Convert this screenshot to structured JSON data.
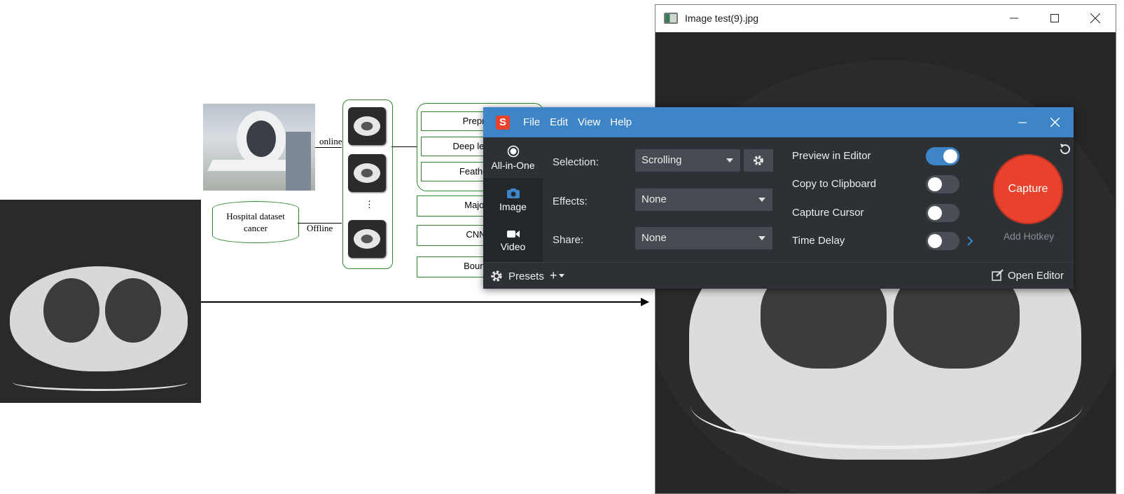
{
  "diagram": {
    "online_label": "online",
    "offline_label": "Offline",
    "dataset_label": "Hospital dataset cancer",
    "ellipsis": "⋮",
    "steps": [
      "Preproce",
      "Deep learning",
      "Feather ex",
      "Majority",
      "CNN-Y",
      "Boundin"
    ]
  },
  "viewer": {
    "title": "Image test(9).jpg",
    "icons": {
      "minimize": "minimize-icon",
      "maximize": "maximize-icon",
      "close": "close-icon"
    }
  },
  "capture": {
    "logo_letter": "S",
    "menu": [
      "File",
      "Edit",
      "View",
      "Help"
    ],
    "modes": [
      {
        "label": "All-in-One",
        "icon": "record-icon",
        "active": true
      },
      {
        "label": "Image",
        "icon": "camera-icon",
        "active": false
      },
      {
        "label": "Video",
        "icon": "video-camera-icon",
        "active": false
      }
    ],
    "selection_label": "Selection:",
    "selection_value": "Scrolling",
    "effects_label": "Effects:",
    "effects_value": "None",
    "share_label": "Share:",
    "share_value": "None",
    "options": [
      {
        "label": "Preview in Editor",
        "on": true
      },
      {
        "label": "Copy to Clipboard",
        "on": false
      },
      {
        "label": "Capture Cursor",
        "on": false
      },
      {
        "label": "Time Delay",
        "on": false
      }
    ],
    "capture_button": "Capture",
    "add_hotkey": "Add Hotkey",
    "presets_label": "Presets",
    "add_preset": "+",
    "open_editor": "Open Editor",
    "accent_color": "#3d85c6",
    "capture_color": "#e8412c"
  }
}
